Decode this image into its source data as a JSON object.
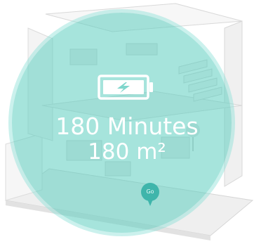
{
  "stats": {
    "battery_icon": "battery-charging-icon",
    "time_label": "180 Minutes",
    "area_label": "180 m²"
  },
  "go_button": {
    "label": "Go",
    "icon": "map-pin-icon"
  },
  "colors": {
    "overlay": "#5ccdc0",
    "pin": "#3fb5ab",
    "text": "#ffffff"
  }
}
